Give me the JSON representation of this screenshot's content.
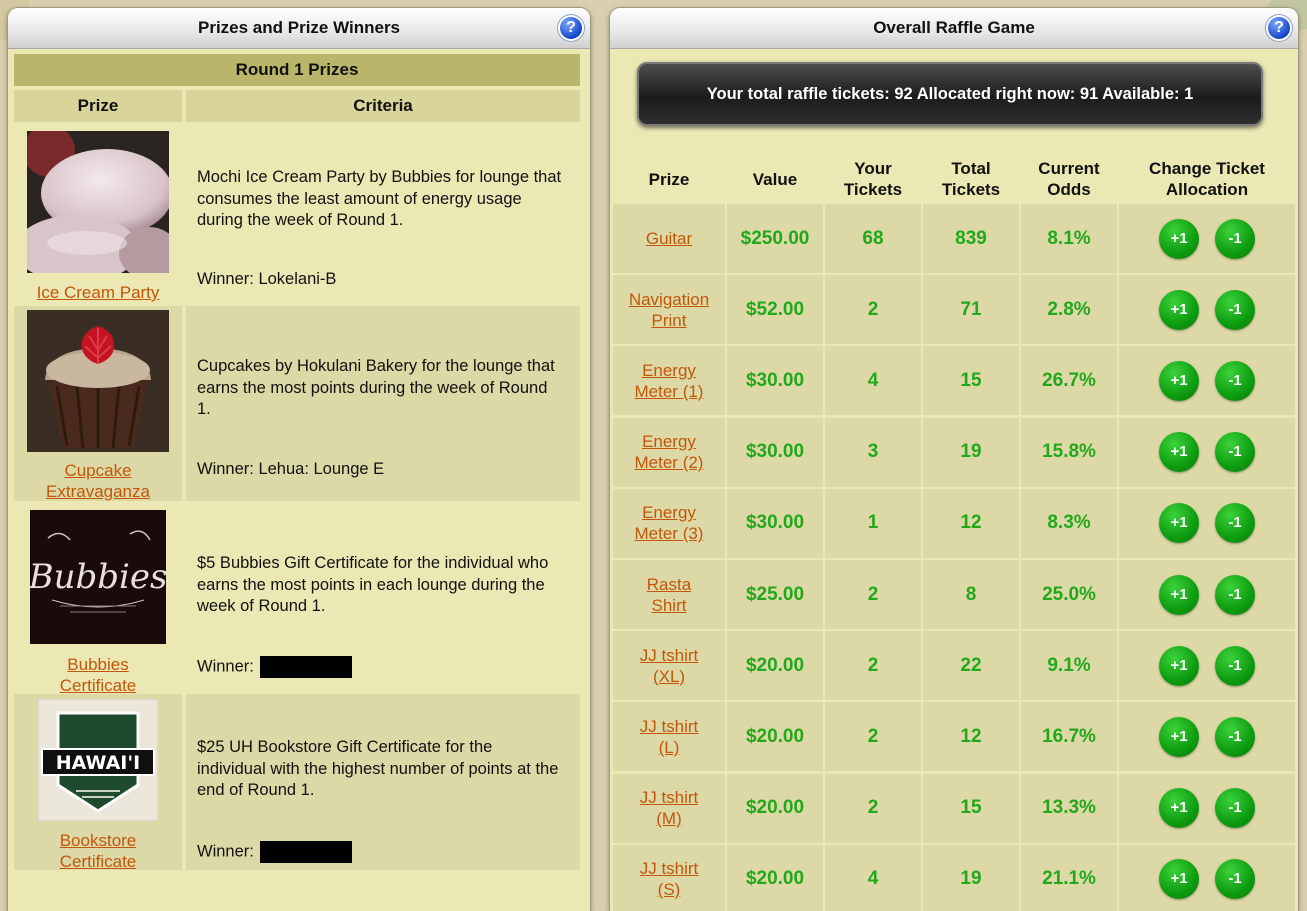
{
  "left_panel": {
    "title": "Prizes and Prize Winners",
    "round_title": "Round 1 Prizes",
    "col_prize": "Prize",
    "col_criteria": "Criteria",
    "prizes": [
      {
        "link1": "Ice Cream Party",
        "link2": "",
        "image": "mochi-ice-cream-image",
        "criteria": "Mochi Ice Cream Party by Bubbies for lounge that consumes the least amount of energy usage during the week of Round 1.",
        "winner_label": "Winner:",
        "winner_name": "Lokelani-B"
      },
      {
        "link1": "Cupcake",
        "link2": "Extravaganza",
        "image": "cupcake-image",
        "criteria": "Cupcakes by Hokulani Bakery for the lounge that earns the most points during the week of Round 1.",
        "winner_label": "Winner:",
        "winner_name": "Lehua: Lounge E"
      },
      {
        "link1": "Bubbies",
        "link2": "Certificate",
        "image": "bubbies-logo",
        "logo_text": "Bubbies",
        "criteria": "$5 Bubbies Gift Certificate for the individual who earns the most points in each lounge during the week of Round 1.",
        "winner_label": "Winner:",
        "winner_name": ""
      },
      {
        "link1": "Bookstore",
        "link2": "Certificate",
        "image": "hawaii-bookstore-logo",
        "logo_text": "HAWAI'I",
        "criteria": "$25 UH Bookstore Gift Certificate for the individual with the highest number of points at the end of Round 1.",
        "winner_label": "Winner:",
        "winner_name": ""
      }
    ]
  },
  "right_panel": {
    "title": "Overall Raffle Game",
    "tickets_summary": "Your total raffle tickets: 92 Allocated right now: 91 Available: 1",
    "columns": {
      "prize": "Prize",
      "value": "Value",
      "your1": "Your",
      "your2": "Tickets",
      "total1": "Total",
      "total2": "Tickets",
      "odds1": "Current",
      "odds2": "Odds",
      "change1": "Change Ticket",
      "change2": "Allocation"
    },
    "plus_label": "+1",
    "minus_label": "-1",
    "rows": [
      {
        "l1": "Guitar",
        "l2": "",
        "value": "$250.00",
        "yours": "68",
        "total": "839",
        "odds": "8.1%"
      },
      {
        "l1": "Navigation",
        "l2": "Print",
        "value": "$52.00",
        "yours": "2",
        "total": "71",
        "odds": "2.8%"
      },
      {
        "l1": "Energy",
        "l2": "Meter (1)",
        "value": "$30.00",
        "yours": "4",
        "total": "15",
        "odds": "26.7%"
      },
      {
        "l1": "Energy",
        "l2": "Meter (2)",
        "value": "$30.00",
        "yours": "3",
        "total": "19",
        "odds": "15.8%"
      },
      {
        "l1": "Energy",
        "l2": "Meter (3)",
        "value": "$30.00",
        "yours": "1",
        "total": "12",
        "odds": "8.3%"
      },
      {
        "l1": "Rasta",
        "l2": "Shirt",
        "value": "$25.00",
        "yours": "2",
        "total": "8",
        "odds": "25.0%"
      },
      {
        "l1": "JJ tshirt",
        "l2": "(XL)",
        "value": "$20.00",
        "yours": "2",
        "total": "22",
        "odds": "9.1%"
      },
      {
        "l1": "JJ tshirt",
        "l2": "(L)",
        "value": "$20.00",
        "yours": "2",
        "total": "12",
        "odds": "16.7%"
      },
      {
        "l1": "JJ tshirt",
        "l2": "(M)",
        "value": "$20.00",
        "yours": "2",
        "total": "15",
        "odds": "13.3%"
      },
      {
        "l1": "JJ tshirt",
        "l2": "(S)",
        "value": "$20.00",
        "yours": "4",
        "total": "19",
        "odds": "21.1%"
      }
    ]
  },
  "colors": {
    "accent_green": "#22a81c",
    "link_orange": "#c2570a",
    "panel_bg": "#ebe8b4",
    "round_bar": "#b9b56a"
  },
  "icons": [
    "help-icon"
  ]
}
